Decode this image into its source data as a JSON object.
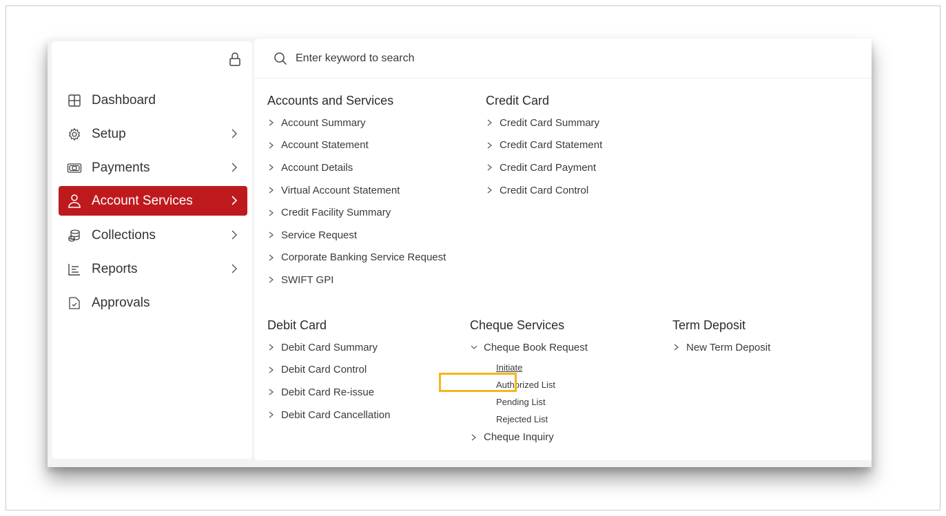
{
  "search": {
    "placeholder": "Enter keyword to search"
  },
  "sidebar": {
    "items": [
      {
        "label": "Dashboard",
        "icon": "grid-icon",
        "has_chevron": false
      },
      {
        "label": "Setup",
        "icon": "gear-icon",
        "has_chevron": true
      },
      {
        "label": "Payments",
        "icon": "banknote-icon",
        "has_chevron": true
      },
      {
        "label": "Account Services",
        "icon": "user-icon",
        "has_chevron": true,
        "active": true
      },
      {
        "label": "Collections",
        "icon": "coins-icon",
        "has_chevron": true
      },
      {
        "label": "Reports",
        "icon": "report-icon",
        "has_chevron": true
      },
      {
        "label": "Approvals",
        "icon": "document-check-icon",
        "has_chevron": false
      }
    ]
  },
  "groups": {
    "accounts": {
      "title": "Accounts and Services",
      "links": [
        "Account Summary",
        "Account Statement",
        "Account Details",
        "Virtual Account Statement",
        "Credit Facility Summary",
        "Service Request",
        "Corporate Banking Service Request",
        "SWIFT GPI"
      ]
    },
    "credit_card": {
      "title": "Credit Card",
      "links": [
        "Credit Card Summary",
        "Credit Card Statement",
        "Credit Card Payment",
        "Credit Card Control"
      ]
    },
    "debit_card": {
      "title": "Debit Card",
      "links": [
        "Debit Card Summary",
        "Debit Card Control",
        "Debit Card Re-issue",
        "Debit Card Cancellation"
      ]
    },
    "cheque": {
      "title": "Cheque Services",
      "expanded": {
        "label": "Cheque Book Request",
        "sub": [
          "Initiate",
          "Authorized List",
          "Pending List",
          "Rejected List"
        ]
      },
      "next": "Cheque Inquiry"
    },
    "term_deposit": {
      "title": "Term Deposit",
      "links": [
        "New Term Deposit"
      ]
    }
  },
  "colors": {
    "accent": "#be1a1e",
    "highlight": "#f3b61c"
  }
}
